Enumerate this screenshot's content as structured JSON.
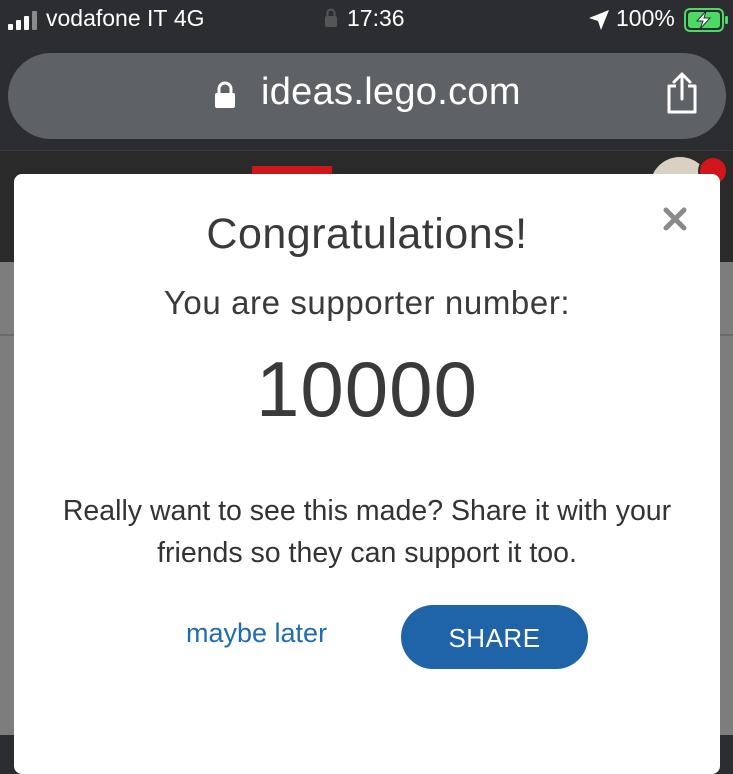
{
  "status_bar": {
    "carrier": "vodafone IT",
    "network": "4G",
    "time": "17:36",
    "battery_percent": "100%"
  },
  "browser": {
    "url": "ideas.lego.com"
  },
  "modal": {
    "title": "Congratulations!",
    "subtitle": "You are supporter number:",
    "supporter_number": "10000",
    "message": "Really want to see this made? Share it with your friends so they can support it too.",
    "maybe_later_label": "maybe later",
    "share_label": "SHARE"
  },
  "colors": {
    "link_blue": "#1f6cb0",
    "share_button": "#1f63a8",
    "notification_red": "#d0161a",
    "battery_green": "#4cd964"
  },
  "icons": [
    "signal-icon",
    "lock-icon",
    "location-arrow-icon",
    "battery-charging-icon",
    "share-icon",
    "close-icon",
    "avatar",
    "notification-dot"
  ]
}
